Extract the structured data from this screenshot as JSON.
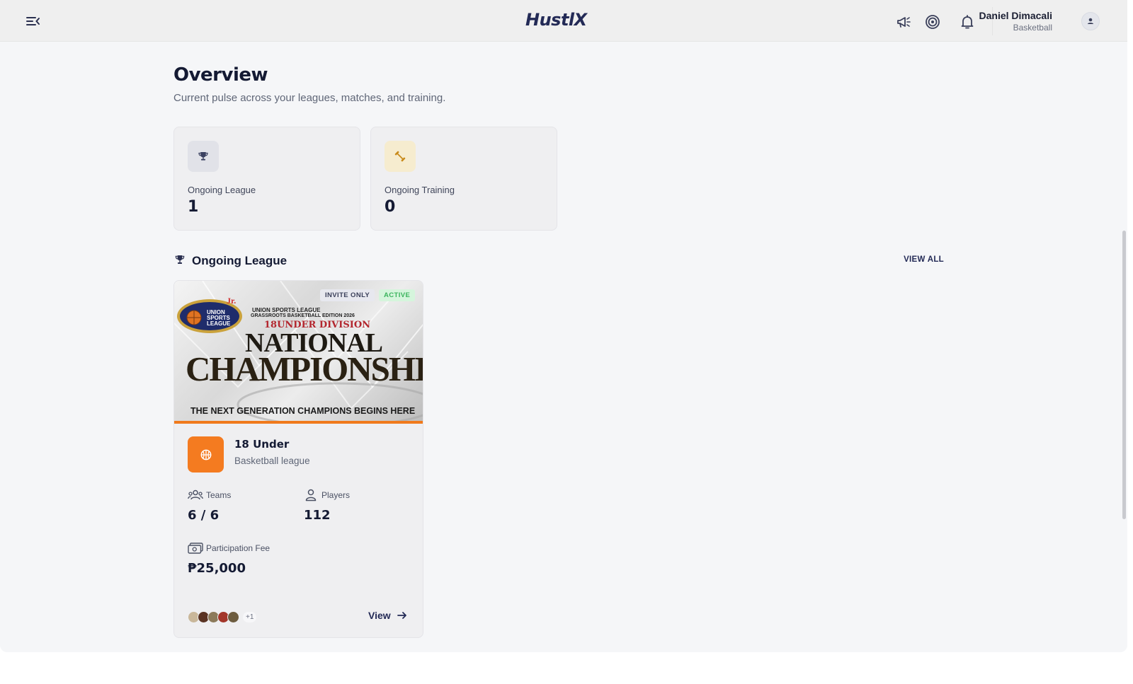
{
  "topbar": {
    "logo": "HustlX",
    "icons": [
      "menu-collapse-icon",
      "megaphone-icon",
      "target-icon",
      "bell-icon"
    ],
    "user": {
      "name": "Daniel Dimacali",
      "sport": "Basketball"
    }
  },
  "page": {
    "title": "Overview",
    "subtitle": "Current pulse across your leagues, matches, and training."
  },
  "stats": [
    {
      "label": "Ongoing League",
      "value": "1",
      "icon": "trophy-icon",
      "icon_bg": "#e1e2e8",
      "icon_color": "#3b4160"
    },
    {
      "label": "Ongoing Training",
      "value": "0",
      "icon": "dumbbell-icon",
      "icon_bg": "#f6eccf",
      "icon_color": "#c88a1a"
    }
  ],
  "section": {
    "title": "Ongoing League",
    "view_all": "VIEW ALL"
  },
  "league": {
    "badges": {
      "invite": "INVITE ONLY",
      "status": "ACTIVE"
    },
    "banner": {
      "logo_text": "UNION SPORTS LEAGUE",
      "logo_jr": "Jr.",
      "line1": "UNION SPORTS LEAGUE",
      "line2": "GRASSROOTS BASKETBALL EDITION 2026",
      "division": "18UNDER DIVISION",
      "national": "NATIONAL",
      "championship": "CHAMPIONSHIP",
      "tagline": "THE NEXT GENERATION CHAMPIONS BEGINS HERE"
    },
    "name": "18 Under",
    "type": "Basketball league",
    "teams_label": "Teams",
    "teams_value": "6 / 6",
    "players_label": "Players",
    "players_value": "112",
    "fee_label": "Participation Fee",
    "fee_value": "₱25,000",
    "more_teams": "+1",
    "view_label": "View",
    "accent": "#f47b20"
  }
}
